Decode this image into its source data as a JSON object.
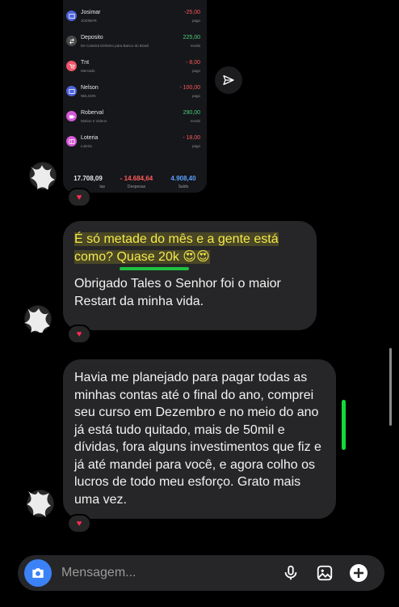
{
  "shared_screenshot": {
    "transactions": [
      {
        "name": "Josimar",
        "sub": "JOZIMAR",
        "amount": "-25,00",
        "status": "pago",
        "type": "neg",
        "icon": "bank-icon",
        "color": "#4f63d9"
      },
      {
        "name": "Deposito",
        "sub": "De Carteira Dinheiro para Banco do Brasil",
        "amount": "225,00",
        "status": "recebi",
        "type": "pos",
        "icon": "transfer-icon",
        "color": "#4a4a4a"
      },
      {
        "name": "Tnt",
        "sub": "Mercado",
        "amount": "- 8,00",
        "status": "pago",
        "type": "neg",
        "icon": "cart-icon",
        "color": "#f0566a"
      },
      {
        "name": "Nelson",
        "sub": "NELSON",
        "amount": "- 100,00",
        "status": "pago",
        "type": "neg",
        "icon": "bank-icon",
        "color": "#4f63d9"
      },
      {
        "name": "Roberval",
        "sub": "Motion e Videos",
        "amount": "290,00",
        "status": "recebi",
        "type": "pos",
        "icon": "video-icon",
        "color": "#d658d6"
      },
      {
        "name": "Loteria",
        "sub": "Loteria",
        "amount": "- 18,00",
        "status": "pago",
        "type": "neg",
        "icon": "ticket-icon",
        "color": "#d658d6"
      }
    ],
    "summary": {
      "receitas_value": "17.708,09",
      "receitas_label": "tas",
      "despesas_value": "- 14.684,64",
      "despesas_label": "Despesas",
      "saldo_value": "4.908,40",
      "saldo_label": "Saldo"
    }
  },
  "messages": [
    {
      "highlight": "É só metade do mês e a gente está como? Quase 20k 😍😍",
      "text": "Obrigado Tales o Senhor foi o maior Restart da minha vida.",
      "reaction": "♥"
    },
    {
      "text": "Havia me planejado para pagar todas as minhas contas até o final do ano, comprei seu curso em Dezembro e no meio do ano já está tudo quitado, mais de 50mil e dívidas, fora alguns investimentos  que fiz e já até mandei para você, e agora colho os lucros de todo meu esforço. Grato mais uma vez.",
      "reaction": "♥"
    }
  ],
  "first_reaction": "♥",
  "composer": {
    "placeholder": "Mensagem..."
  },
  "colors": {
    "accent": "#3b82f6",
    "reaction": "#ff2d55",
    "highlight_text": "#f6e94a",
    "marker": "#16d83a"
  }
}
